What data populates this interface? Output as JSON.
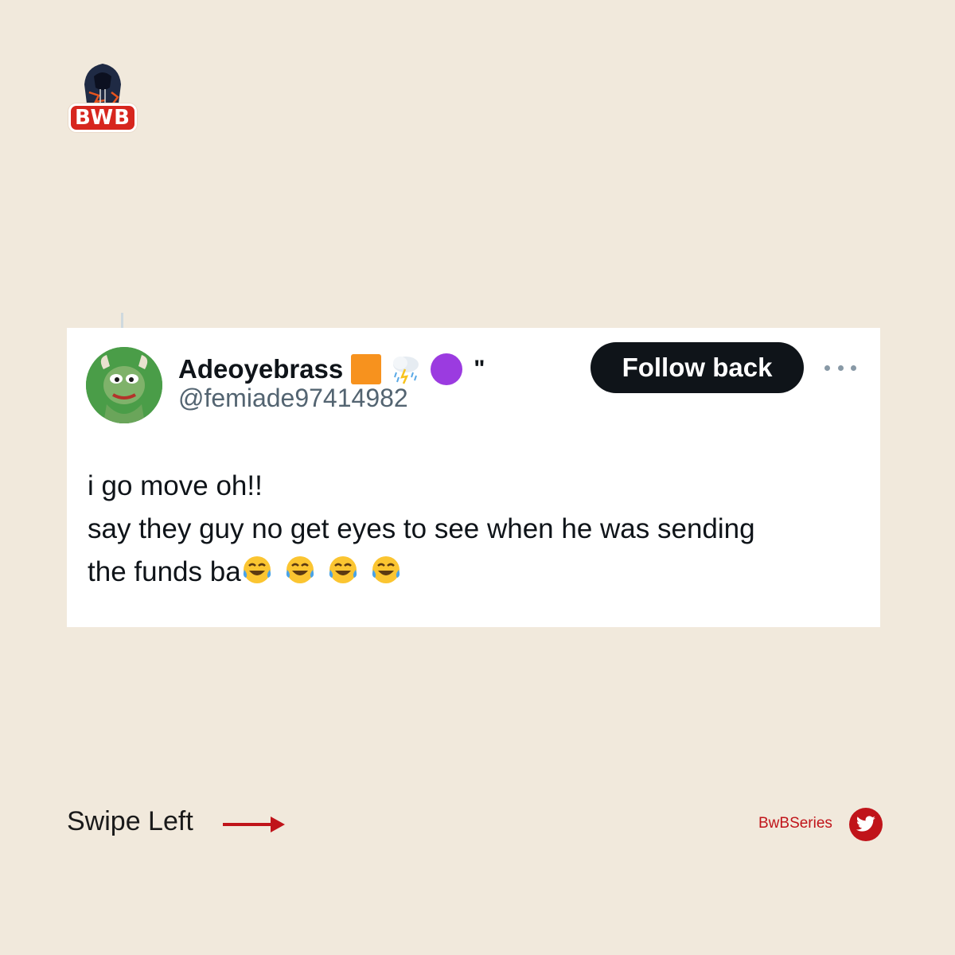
{
  "brand": {
    "badge_text": "BWB"
  },
  "tweet": {
    "author_name": "Adeoyebrass",
    "name_emojis": [
      "orange-square",
      "cloud-with-lightning-and-rain",
      "purple-circle"
    ],
    "name_suffix": "\"",
    "handle": "@femiade97414982",
    "follow_label": "Follow back",
    "body_lines": [
      "i go move oh!!",
      "say they guy no get eyes to see when  he was sending",
      "the funds ba"
    ],
    "trailing_emoji": "face-with-tears-of-joy",
    "trailing_emoji_count": 4
  },
  "footer": {
    "swipe_label": "Swipe Left",
    "social_handle": "BwBSeries",
    "social_icon": "twitter-bird-icon"
  },
  "colors": {
    "background": "#f1e9dc",
    "brand_red": "#c0141a",
    "button_dark": "#0f1419"
  }
}
